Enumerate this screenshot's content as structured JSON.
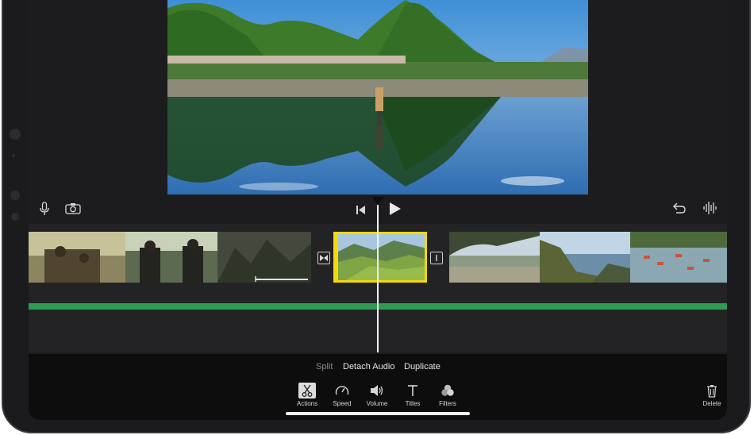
{
  "toolbar_top": {
    "left_icons": [
      "microphone-icon",
      "camera-icon"
    ],
    "center_icons": [
      "skip-to-start-icon",
      "play-icon"
    ],
    "right_icons": [
      "undo-icon",
      "audio-waveform-icon"
    ]
  },
  "clip_actions": {
    "split_label": "Split",
    "detach_audio_label": "Detach Audio",
    "duplicate_label": "Duplicate"
  },
  "tools": {
    "actions_label": "Actions",
    "speed_label": "Speed",
    "volume_label": "Volume",
    "titles_label": "Titles",
    "filters_label": "Filters",
    "delete_label": "Delete"
  },
  "colors": {
    "selected_clip_border": "#f5d90a",
    "audio_track": "#2e9b52"
  }
}
